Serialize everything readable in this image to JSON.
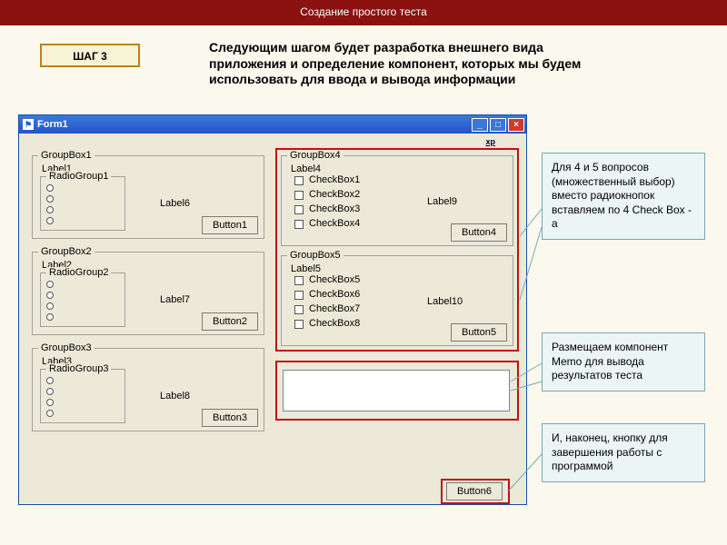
{
  "banner": "Создание простого теста",
  "step": "ШАГ 3",
  "intro": "   Следующим шагом будет разработка внешнего вида приложения и определение компонент, которых мы будем использовать для ввода и вывода информации",
  "window": {
    "title": "Form1"
  },
  "groups": {
    "g1": {
      "title": "GroupBox1",
      "label": "Label1",
      "radio": "RadioGroup1",
      "side": "Label6",
      "btn": "Button1"
    },
    "g2": {
      "title": "GroupBox2",
      "label": "Label2",
      "radio": "RadioGroup2",
      "side": "Label7",
      "btn": "Button2"
    },
    "g3": {
      "title": "GroupBox3",
      "label": "Label3",
      "radio": "RadioGroup3",
      "side": "Label8",
      "btn": "Button3"
    },
    "g4": {
      "title": "GroupBox4",
      "label": "Label4",
      "checks": [
        "CheckBox1",
        "CheckBox2",
        "CheckBox3",
        "CheckBox4"
      ],
      "side": "Label9",
      "btn": "Button4"
    },
    "g5": {
      "title": "GroupBox5",
      "label": "Label5",
      "checks": [
        "CheckBox5",
        "CheckBox6",
        "CheckBox7",
        "CheckBox8"
      ],
      "side": "Label10",
      "btn": "Button5"
    }
  },
  "button6": "Button6",
  "callouts": {
    "c1": "   Для 4 и 5 вопросов (множественный выбор) вместо радиокнопок вставляем по 4 Check Box - а",
    "c2": "   Размещаем компонент Memo для вывода результатов теста",
    "c3": "   И, наконец, кнопку для завершения работы с программой"
  }
}
